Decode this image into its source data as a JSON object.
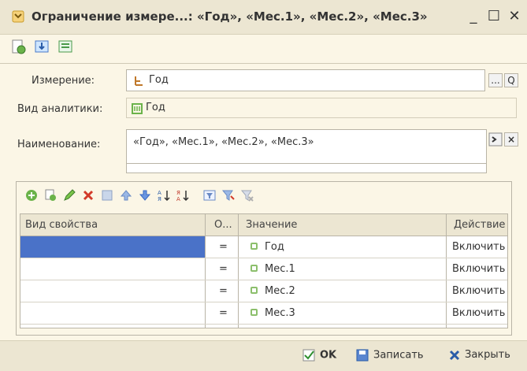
{
  "window": {
    "title": "Ограничение измере...: «Год», «Мес.1», «Мес.2», «Мес.3»",
    "minimize": "_",
    "maximize": "☐",
    "close": "✕"
  },
  "form": {
    "dimension_label": "Измерение:",
    "dimension_value": "Год",
    "analytics_label": "Вид аналитики:",
    "analytics_value": "Год",
    "name_label": "Наименование:",
    "name_value": "«Год», «Мес.1», «Мес.2», «Мес.3»",
    "select_btn": "...",
    "search_btn": "Q",
    "clear_btn": "×"
  },
  "grid": {
    "columns": [
      "Вид свойства",
      "О...",
      "Значение",
      "Действие"
    ],
    "rows": [
      {
        "property": "",
        "op": "=",
        "value": "Год",
        "action": "Включить"
      },
      {
        "property": "",
        "op": "=",
        "value": "Мес.1",
        "action": "Включить"
      },
      {
        "property": "",
        "op": "=",
        "value": "Мес.2",
        "action": "Включить"
      },
      {
        "property": "",
        "op": "=",
        "value": "Мес.3",
        "action": "Включить"
      }
    ]
  },
  "footer": {
    "ok": "OK",
    "save": "Записать",
    "close": "Закрыть"
  },
  "colors": {
    "selection": "#4a72c8",
    "background": "#fbf6e6",
    "accent_green": "#8cbf6c"
  }
}
